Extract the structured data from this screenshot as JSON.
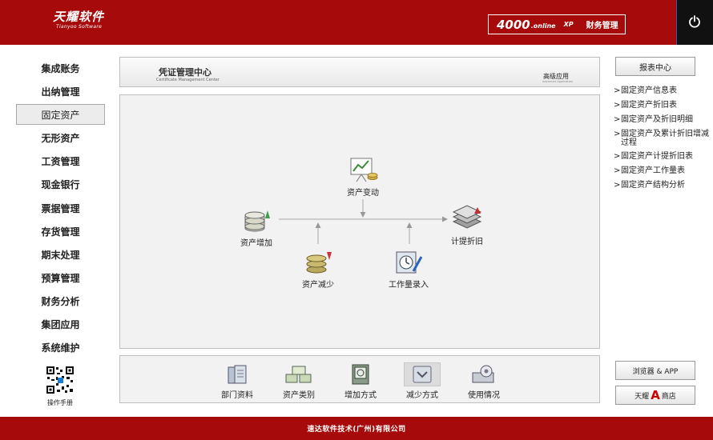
{
  "header": {
    "logo_main": "天耀软件",
    "logo_sub": "Tianyoo Software",
    "product_big": "4000",
    "product_small": ".online",
    "product_xp": "XP",
    "product_name": "财务管理"
  },
  "nav": {
    "items": [
      {
        "label": "集成账务"
      },
      {
        "label": "出纳管理"
      },
      {
        "label": "固定资产",
        "active": true
      },
      {
        "label": "无形资产"
      },
      {
        "label": "工资管理"
      },
      {
        "label": "现金银行"
      },
      {
        "label": "票据管理"
      },
      {
        "label": "存货管理"
      },
      {
        "label": "期末处理"
      },
      {
        "label": "预算管理"
      },
      {
        "label": "财务分析"
      },
      {
        "label": "集团应用"
      },
      {
        "label": "系统维护"
      }
    ],
    "manual_label": "操作手册"
  },
  "title_panel": {
    "title": "凭证管理中心",
    "subtitle": "Certificate Management Center",
    "advanced": "高级应用",
    "advanced_sub": "Advanced Application"
  },
  "flow": {
    "asset_change": "资产变动",
    "asset_add": "资产增加",
    "depreciation": "计提折旧",
    "asset_reduce": "资产减少",
    "workload_entry": "工作量录入"
  },
  "bottom_tools": [
    {
      "label": "部门资料",
      "icon": "department-icon"
    },
    {
      "label": "资产类别",
      "icon": "asset-category-icon"
    },
    {
      "label": "增加方式",
      "icon": "add-method-icon"
    },
    {
      "label": "减少方式",
      "icon": "reduce-method-icon"
    },
    {
      "label": "使用情况",
      "icon": "usage-icon"
    }
  ],
  "right": {
    "report_center": "报表中心",
    "arrow": ">",
    "links": [
      {
        "label": "固定资产信息表"
      },
      {
        "label": "固定资产折旧表"
      },
      {
        "label": "固定资产及折旧明细"
      },
      {
        "label": "固定资产及累计折旧增减过程"
      },
      {
        "label": "固定资产计提折旧表"
      },
      {
        "label": "固定资产工作量表"
      },
      {
        "label": "固定资产结构分析"
      }
    ],
    "browser_app": "浏览器 & APP",
    "store_prefix": "天耀",
    "store_a": "A",
    "store_suffix": "商店"
  },
  "footer": {
    "company": "速达软件技术(广州)有限公司"
  },
  "colors": {
    "brand_red": "#a60a0a",
    "power_bg": "#111111"
  }
}
